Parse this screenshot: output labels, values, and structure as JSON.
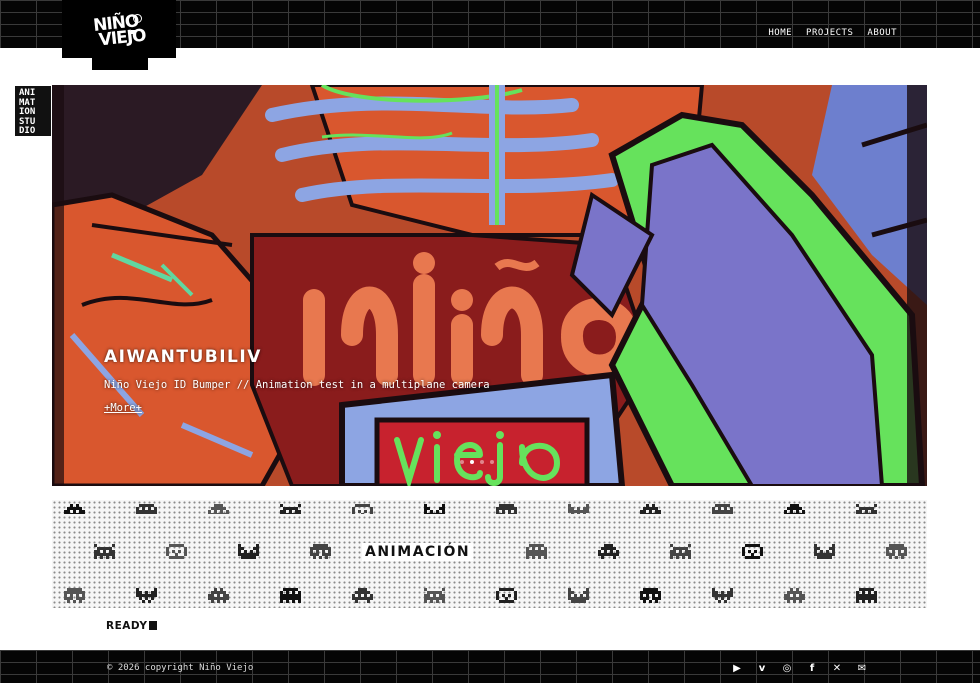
{
  "header": {
    "logo": {
      "line1": "NIÑO",
      "line2": "VIEJO"
    },
    "nav": [
      "HOME",
      "PROJECTS",
      "ABOUT"
    ]
  },
  "side_badge": {
    "lines": [
      "ANI",
      "MAT",
      "ION",
      "STU",
      "DIO"
    ]
  },
  "hero": {
    "title": "AIWANTUBILIV",
    "description": "Niño Viejo ID Bumper // Animation test in a multiplane camera",
    "more_link": "+More+",
    "artwork_words": [
      "niño",
      "VIEJO"
    ],
    "slide_count": 4,
    "active_slide": 1
  },
  "strip": {
    "label": "ANIMACIÓN",
    "sprite_icons": [
      "pixel-bug-icon",
      "pixel-ghost-icon",
      "pixel-alien-icon",
      "pixel-invader-icon",
      "pixel-face-icon",
      "pixel-cat-icon",
      "pixel-skull-icon",
      "pixel-bat-icon"
    ]
  },
  "status": {
    "ready_text": "READY"
  },
  "footer": {
    "copyright": "© 2026 copyright Niño Viejo",
    "social": [
      {
        "icon": "youtube-icon",
        "glyph": "▶"
      },
      {
        "icon": "vimeo-icon",
        "glyph": "v"
      },
      {
        "icon": "instagram-icon",
        "glyph": "◎"
      },
      {
        "icon": "facebook-icon",
        "glyph": "f"
      },
      {
        "icon": "x-icon",
        "glyph": "✕"
      },
      {
        "icon": "email-icon",
        "glyph": "✉"
      }
    ]
  },
  "colors": {
    "background": "#ffffff",
    "bar": "#050505",
    "hero_orange": "#d9572e",
    "hero_blue": "#8da5e3",
    "hero_green": "#66e25c",
    "hero_purple": "#7a74c9"
  }
}
